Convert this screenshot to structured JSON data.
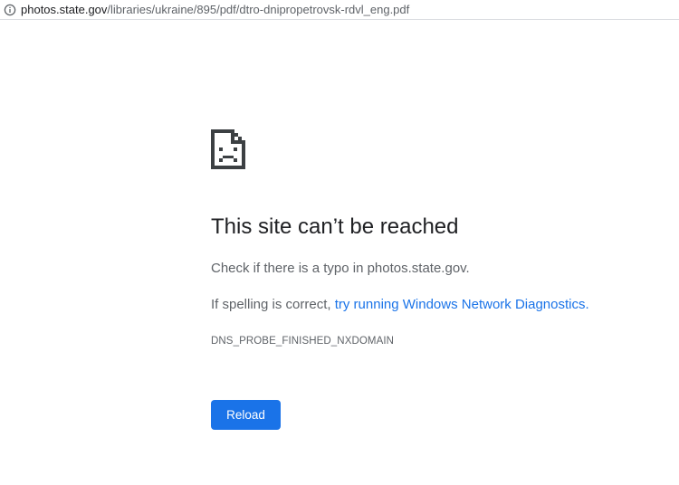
{
  "address_bar": {
    "icon": "info-icon",
    "url_host": "photos.state.gov",
    "url_path": "/libraries/ukraine/895/pdf/dtro-dnipropetrovsk-rdvl_eng.pdf"
  },
  "error": {
    "icon": "sad-document-icon",
    "title": "This site can’t be reached",
    "message_1": "Check if there is a typo in photos.state.gov.",
    "message_2_prefix": "If spelling is correct, ",
    "diagnostics_link": "try running Windows Network Diagnostics.",
    "error_code": "DNS_PROBE_FINISHED_NXDOMAIN"
  },
  "actions": {
    "reload_label": "Reload"
  },
  "colors": {
    "accent": "#1a73e8",
    "text_primary": "#202124",
    "text_secondary": "#5f6368"
  }
}
